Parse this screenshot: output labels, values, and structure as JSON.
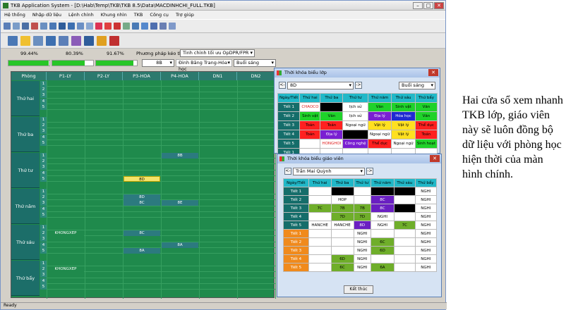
{
  "app": {
    "title": "TKB Application System - [D:\\Hab\\Temp\\TKB\\TKB 8.5\\Data\\MACDINHCHI_FULL.TKB]"
  },
  "menu": [
    "Hệ thống",
    "Nhập dữ liệu",
    "Lệnh chính",
    "Khung nhìn",
    "TKB",
    "Công cụ",
    "Trợ giúp"
  ],
  "progress": {
    "p1": "99.44%",
    "p2": "80.39%",
    "p3": "91.67%",
    "p1_value": 0.99,
    "p2_value": 0.8,
    "p3_value": 0.92,
    "method_label": "Phương pháp kéo thả:",
    "method_value": "Tinh chỉnh tối ưu OpDPR/FPR",
    "class_value": "8B",
    "teacher_value": "Đinh Băng Trang-Hóa học",
    "session_value": "Buổi sáng"
  },
  "grid": {
    "corner": "Phòng",
    "columns": [
      "P1-LY",
      "P2-LY",
      "P3-HOA",
      "P4-HOA",
      "DN1",
      "DN2"
    ],
    "days": [
      "Thứ hai",
      "Thứ ba",
      "Thứ tư",
      "Thứ năm",
      "Thứ sáu",
      "Thứ bẩy"
    ],
    "periods": [
      "1",
      "2",
      "3",
      "4",
      "5"
    ],
    "cells": [
      {
        "day": 2,
        "period": 1,
        "col": 3,
        "text": "8B",
        "color": "#2c7a7f"
      },
      {
        "day": 2,
        "period": 5,
        "col": 2,
        "text": "8D",
        "color": "#f3e36a"
      },
      {
        "day": 3,
        "period": 2,
        "col": 2,
        "text": "8D",
        "color": "#2c7a7f"
      },
      {
        "day": 3,
        "period": 3,
        "col": 2,
        "text": "8C",
        "color": "#2c7a7f"
      },
      {
        "day": 3,
        "period": 3,
        "col": 3,
        "text": "8E",
        "color": "#2c7a7f"
      },
      {
        "day": 4,
        "period": 2,
        "col": 0,
        "text": "KHONGXEP",
        "color": "#1f8a4c"
      },
      {
        "day": 4,
        "period": 2,
        "col": 2,
        "text": "8C",
        "color": "#2c7a7f"
      },
      {
        "day": 4,
        "period": 4,
        "col": 3,
        "text": "8A",
        "color": "#2c7a7f"
      },
      {
        "day": 4,
        "period": 5,
        "col": 2,
        "text": "8A",
        "color": "#2c7a7f"
      },
      {
        "day": 5,
        "period": 2,
        "col": 0,
        "text": "KHONGXEP",
        "color": "#1f8a4c"
      }
    ]
  },
  "status": "Ready",
  "class_window": {
    "title": "Thời khóa biểu lớp",
    "class": "8D",
    "session": "Buổi sáng",
    "headers": [
      "Ngày/Tiết",
      "Thứ hai",
      "Thứ ba",
      "Thứ tư",
      "Thứ năm",
      "Thứ sáu",
      "Thứ bẩy"
    ],
    "rows": [
      {
        "label": "Tiết 1",
        "cells": [
          {
            "t": "CHAOCO",
            "bg": "#ffffff",
            "fg": "#e02020"
          },
          {
            "t": "",
            "bg": "#000000"
          },
          {
            "t": "lịch sử",
            "bg": "#ffffff"
          },
          {
            "t": "Văn",
            "bg": "#1fd22a"
          },
          {
            "t": "Sinh vật",
            "bg": "#1fd22a"
          },
          {
            "t": "Văn",
            "bg": "#1fd22a"
          }
        ]
      },
      {
        "label": "Tiết 2",
        "cells": [
          {
            "t": "Sinh vật",
            "bg": "#1fd22a"
          },
          {
            "t": "Văn",
            "bg": "#1fd22a"
          },
          {
            "t": "lịch sử",
            "bg": "#ffffff"
          },
          {
            "t": "Địa lý",
            "bg": "#7a1fd2"
          },
          {
            "t": "Hóa học",
            "bg": "#1f2ad2"
          },
          {
            "t": "Văn",
            "bg": "#1fd22a"
          }
        ]
      },
      {
        "label": "Tiết 3",
        "cells": [
          {
            "t": "Toán",
            "bg": "#ff2020"
          },
          {
            "t": "Toán",
            "bg": "#ff2020"
          },
          {
            "t": "Ngoại ngữ",
            "bg": "#ffffff"
          },
          {
            "t": "Vật lý",
            "bg": "#ffe020"
          },
          {
            "t": "Vật lý",
            "bg": "#ffe020"
          },
          {
            "t": "Thể dục",
            "bg": "#ff2020"
          }
        ]
      },
      {
        "label": "Tiết 4",
        "cells": [
          {
            "t": "Toán",
            "bg": "#ff2020"
          },
          {
            "t": "Địa lý",
            "bg": "#7a1fd2"
          },
          {
            "t": "",
            "bg": "#000000"
          },
          {
            "t": "Ngoại ngữ",
            "bg": "#ffffff"
          },
          {
            "t": "Vật lý",
            "bg": "#ffe020"
          },
          {
            "t": "Toán",
            "bg": "#ff2020"
          }
        ]
      },
      {
        "label": "Tiết 5",
        "cells": [
          {
            "t": "",
            "bg": "#ffffff"
          },
          {
            "t": "HONGHOI",
            "bg": "#ffffff",
            "fg": "#e02020"
          },
          {
            "t": "Công nghệ",
            "bg": "#7a1fd2"
          },
          {
            "t": "Thể dục",
            "bg": "#ff2020"
          },
          {
            "t": "Ngoại ngữ",
            "bg": "#ffffff"
          },
          {
            "t": "Sinh hoạt",
            "bg": "#1fd22a"
          }
        ]
      },
      {
        "label": "Tiết 1",
        "cells": []
      }
    ]
  },
  "teacher_window": {
    "title": "Thời khóa biểu giáo viên",
    "teacher": "Trần Mai Quỳnh",
    "headers": [
      "Ngày/Tiết",
      "Thứ hai",
      "Thứ ba",
      "Thứ tư",
      "Thứ năm",
      "Thứ sáu",
      "Thứ bẩy"
    ],
    "rows": [
      {
        "label": "Tiết 1",
        "orange": false,
        "cells": [
          {
            "t": "",
            "bg": "#ffffff"
          },
          {
            "t": "",
            "bg": "#000000"
          },
          {
            "t": "",
            "bg": "#ffffff"
          },
          {
            "t": "",
            "bg": "#000000"
          },
          {
            "t": "",
            "bg": "#000000"
          },
          {
            "t": "NGHI",
            "bg": "#ffffff"
          }
        ]
      },
      {
        "label": "Tiết 2",
        "orange": false,
        "cells": [
          {
            "t": "",
            "bg": "#ffffff"
          },
          {
            "t": "HOP",
            "bg": "#ffffff"
          },
          {
            "t": "",
            "bg": "#ffffff"
          },
          {
            "t": "8C",
            "bg": "#6a1fc2"
          },
          {
            "t": "",
            "bg": "#ffffff"
          },
          {
            "t": "NGHI",
            "bg": "#ffffff"
          }
        ]
      },
      {
        "label": "Tiết 3",
        "orange": false,
        "cells": [
          {
            "t": "7C",
            "bg": "#6fae2a"
          },
          {
            "t": "7B",
            "bg": "#6fae2a"
          },
          {
            "t": "7B",
            "bg": "#6fae2a"
          },
          {
            "t": "8C",
            "bg": "#6a1fc2"
          },
          {
            "t": "",
            "bg": "#000000"
          },
          {
            "t": "NGHI",
            "bg": "#ffffff"
          }
        ]
      },
      {
        "label": "Tiết 4",
        "orange": false,
        "cells": [
          {
            "t": "",
            "bg": "#ffffff"
          },
          {
            "t": "7D",
            "bg": "#6fae2a"
          },
          {
            "t": "7D",
            "bg": "#6fae2a"
          },
          {
            "t": "NGHI",
            "bg": "#ffffff"
          },
          {
            "t": "",
            "bg": "#ffffff"
          },
          {
            "t": "NGHI",
            "bg": "#ffffff"
          }
        ]
      },
      {
        "label": "Tiết 5",
        "orange": false,
        "cells": [
          {
            "t": "HANCHE",
            "bg": "#ffffff"
          },
          {
            "t": "HANCHE",
            "bg": "#ffffff"
          },
          {
            "t": "8D",
            "bg": "#6a1fc2"
          },
          {
            "t": "NGHI",
            "bg": "#ffffff"
          },
          {
            "t": "7C",
            "bg": "#6fae2a"
          },
          {
            "t": "NGHI",
            "bg": "#ffffff"
          }
        ]
      },
      {
        "label": "Tiết 1",
        "orange": true,
        "cells": [
          {
            "t": "",
            "bg": "#ffffff"
          },
          {
            "t": "",
            "bg": "#ffffff"
          },
          {
            "t": "NGHI",
            "bg": "#ffffff"
          },
          {
            "t": "",
            "bg": "#ffffff"
          },
          {
            "t": "",
            "bg": "#ffffff"
          },
          {
            "t": "NGHI",
            "bg": "#ffffff"
          }
        ]
      },
      {
        "label": "Tiết 2",
        "orange": true,
        "cells": [
          {
            "t": "",
            "bg": "#ffffff"
          },
          {
            "t": "",
            "bg": "#ffffff"
          },
          {
            "t": "NGHI",
            "bg": "#ffffff"
          },
          {
            "t": "6C",
            "bg": "#6fae2a"
          },
          {
            "t": "",
            "bg": "#ffffff"
          },
          {
            "t": "NGHI",
            "bg": "#ffffff"
          }
        ]
      },
      {
        "label": "Tiết 3",
        "orange": true,
        "cells": [
          {
            "t": "",
            "bg": "#ffffff"
          },
          {
            "t": "",
            "bg": "#ffffff"
          },
          {
            "t": "NGHI",
            "bg": "#ffffff"
          },
          {
            "t": "6D",
            "bg": "#6fae2a"
          },
          {
            "t": "",
            "bg": "#ffffff"
          },
          {
            "t": "NGHI",
            "bg": "#ffffff"
          }
        ]
      },
      {
        "label": "Tiết 4",
        "orange": true,
        "cells": [
          {
            "t": "",
            "bg": "#ffffff"
          },
          {
            "t": "6D",
            "bg": "#6fae2a"
          },
          {
            "t": "NGHI",
            "bg": "#ffffff"
          },
          {
            "t": "",
            "bg": "#ffffff"
          },
          {
            "t": "",
            "bg": "#ffffff"
          },
          {
            "t": "NGHI",
            "bg": "#ffffff"
          }
        ]
      },
      {
        "label": "Tiết 5",
        "orange": true,
        "cells": [
          {
            "t": "",
            "bg": "#ffffff"
          },
          {
            "t": "6C",
            "bg": "#6fae2a"
          },
          {
            "t": "NGHI",
            "bg": "#ffffff"
          },
          {
            "t": "6A",
            "bg": "#6fae2a"
          },
          {
            "t": "",
            "bg": "#ffffff"
          },
          {
            "t": "NGHI",
            "bg": "#ffffff"
          }
        ]
      }
    ],
    "close_label": "Kết thúc"
  },
  "caption": "Hai cửa sổ xem nhanh TKB lớp, giáo viên này sẽ luôn đồng bộ dữ liệu với phòng học hiện thời của màn hình chính."
}
